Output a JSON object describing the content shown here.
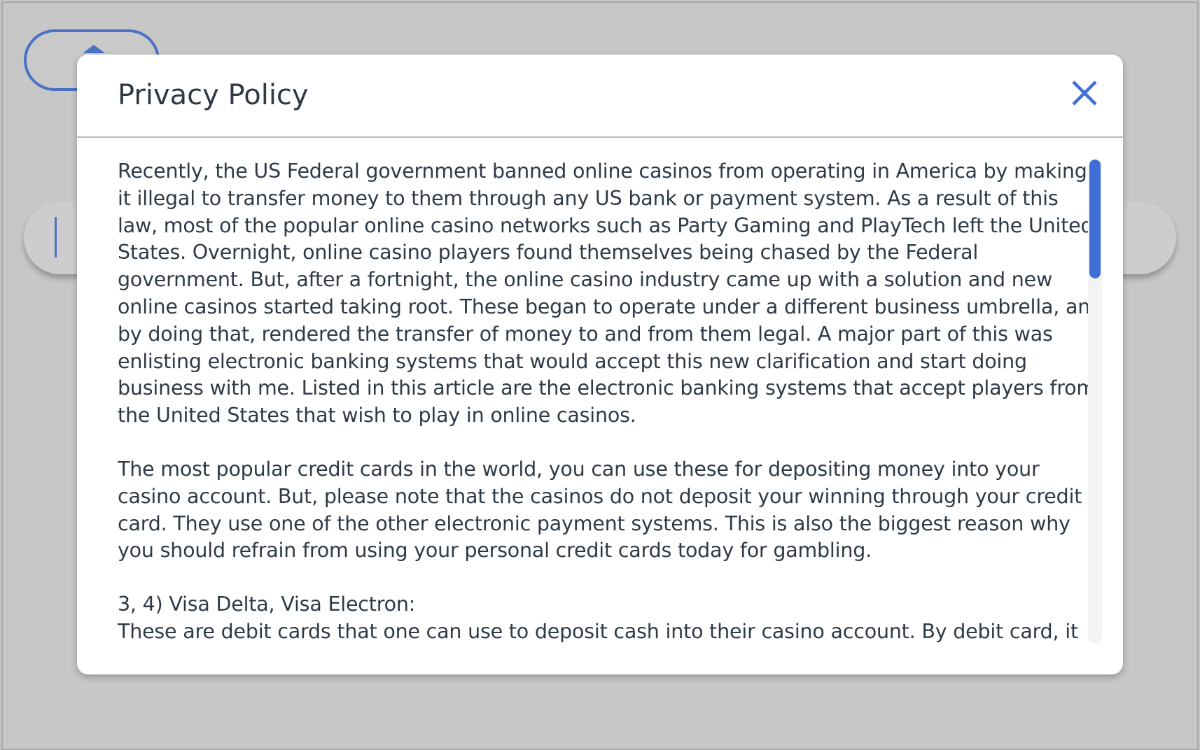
{
  "modal": {
    "title": "Privacy Policy",
    "close_icon": "close-icon",
    "paragraphs": [
      "Recently, the US Federal government banned online casinos from operating in America by making it illegal to transfer money to them through any US bank or payment system. As a result of this law, most of the popular online casino networks such as Party Gaming and PlayTech left the United States. Overnight, online casino players found themselves being chased by the Federal government. But, after a fortnight, the online casino industry came up with a solution and new online casinos started taking root. These began to operate under a different business umbrella, and by doing that, rendered the transfer of money to and from them legal. A major part of this was enlisting electronic banking systems that would accept this new clarification and start doing business with me. Listed in this article are the electronic banking systems that accept players from the United States that wish to play in online casinos.",
      "The most popular credit cards in the world, you can use these for depositing money into your casino account. But, please note that the casinos do not deposit your winning through your credit card. They use one of the other electronic payment systems. This is also the biggest reason why you should refrain from using your personal credit cards today for gambling."
    ],
    "item_heading": "3, 4) Visa Delta, Visa Electron:",
    "item_text": "These are debit cards that one can use to deposit cash into their casino account. By debit card, it"
  },
  "colors": {
    "accent": "#3f6fd6",
    "overlay": "#c7c7c7",
    "text": "#2f3a46"
  }
}
